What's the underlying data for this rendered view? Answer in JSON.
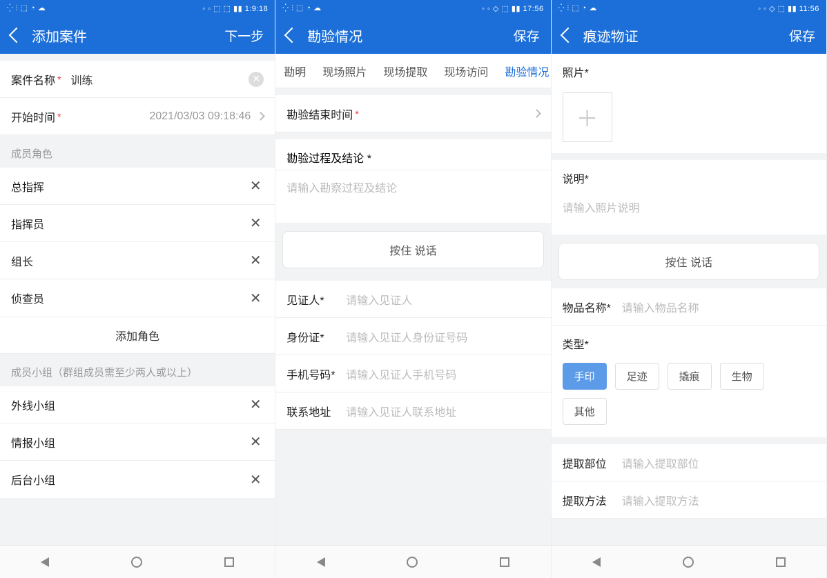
{
  "screen1": {
    "statusbar": {
      "left": "⁛ ⫶ ⬚ ◔ ☁",
      "right": "◦ ◦ ⬚ ⬚ ▮▮ 1:9:18"
    },
    "header": {
      "title": "添加案件",
      "action": "下一步"
    },
    "case_name": {
      "label": "案件名称",
      "value": "训练"
    },
    "start_time": {
      "label": "开始时间",
      "value": "2021/03/03 09:18:46"
    },
    "roles_section": "成员角色",
    "roles": [
      {
        "label": "总指挥"
      },
      {
        "label": "指挥员"
      },
      {
        "label": "组长"
      },
      {
        "label": "侦查员"
      }
    ],
    "add_role": "添加角色",
    "groups_section": "成员小组（群组成员需至少两人或以上）",
    "groups": [
      {
        "label": "外线小组"
      },
      {
        "label": "情报小组"
      },
      {
        "label": "后台小组"
      }
    ]
  },
  "screen2": {
    "statusbar": {
      "left": "⁛ ⫶ ⬚ ◔ ☁",
      "right": "◦ ◦ ◇ ⬚ ▮▮ 17:56"
    },
    "header": {
      "title": "勘验情况",
      "action": "保存"
    },
    "tabs": [
      {
        "label": "勘明",
        "active": false
      },
      {
        "label": "现场照片",
        "active": false
      },
      {
        "label": "现场提取",
        "active": false
      },
      {
        "label": "现场访问",
        "active": false
      },
      {
        "label": "勘验情况",
        "active": true
      }
    ],
    "end_time": {
      "label": "勘验结束时间"
    },
    "process": {
      "label": "勘验过程及结论",
      "placeholder": "请输入勘察过程及结论"
    },
    "voice": "按住 说话",
    "witness": {
      "label": "见证人",
      "placeholder": "请输入见证人"
    },
    "idcard": {
      "label": "身份证",
      "placeholder": "请输入见证人身份证号码"
    },
    "phone": {
      "label": "手机号码",
      "placeholder": "请输入见证人手机号码"
    },
    "address": {
      "label": "联系地址",
      "placeholder": "请输入见证人联系地址"
    }
  },
  "screen3": {
    "statusbar": {
      "left": "⁛ ⫶ ⬚ ◔ ☁",
      "right": "◦ ◦ ◇ ⬚ ▮▮ 11:56"
    },
    "header": {
      "title": "痕迹物证",
      "action": "保存"
    },
    "photo_label": "照片",
    "desc_label": "说明",
    "desc_placeholder": "请输入照片说明",
    "voice": "按住 说话",
    "item_name": {
      "label": "物品名称",
      "placeholder": "请输入物品名称"
    },
    "type_label": "类型",
    "types": [
      {
        "label": "手印",
        "active": true
      },
      {
        "label": "足迹",
        "active": false
      },
      {
        "label": "撬痕",
        "active": false
      },
      {
        "label": "生物",
        "active": false
      },
      {
        "label": "其他",
        "active": false
      }
    ],
    "extract_part": {
      "label": "提取部位",
      "placeholder": "请输入提取部位"
    },
    "extract_method": {
      "label": "提取方法",
      "placeholder": "请输入提取方法"
    }
  }
}
